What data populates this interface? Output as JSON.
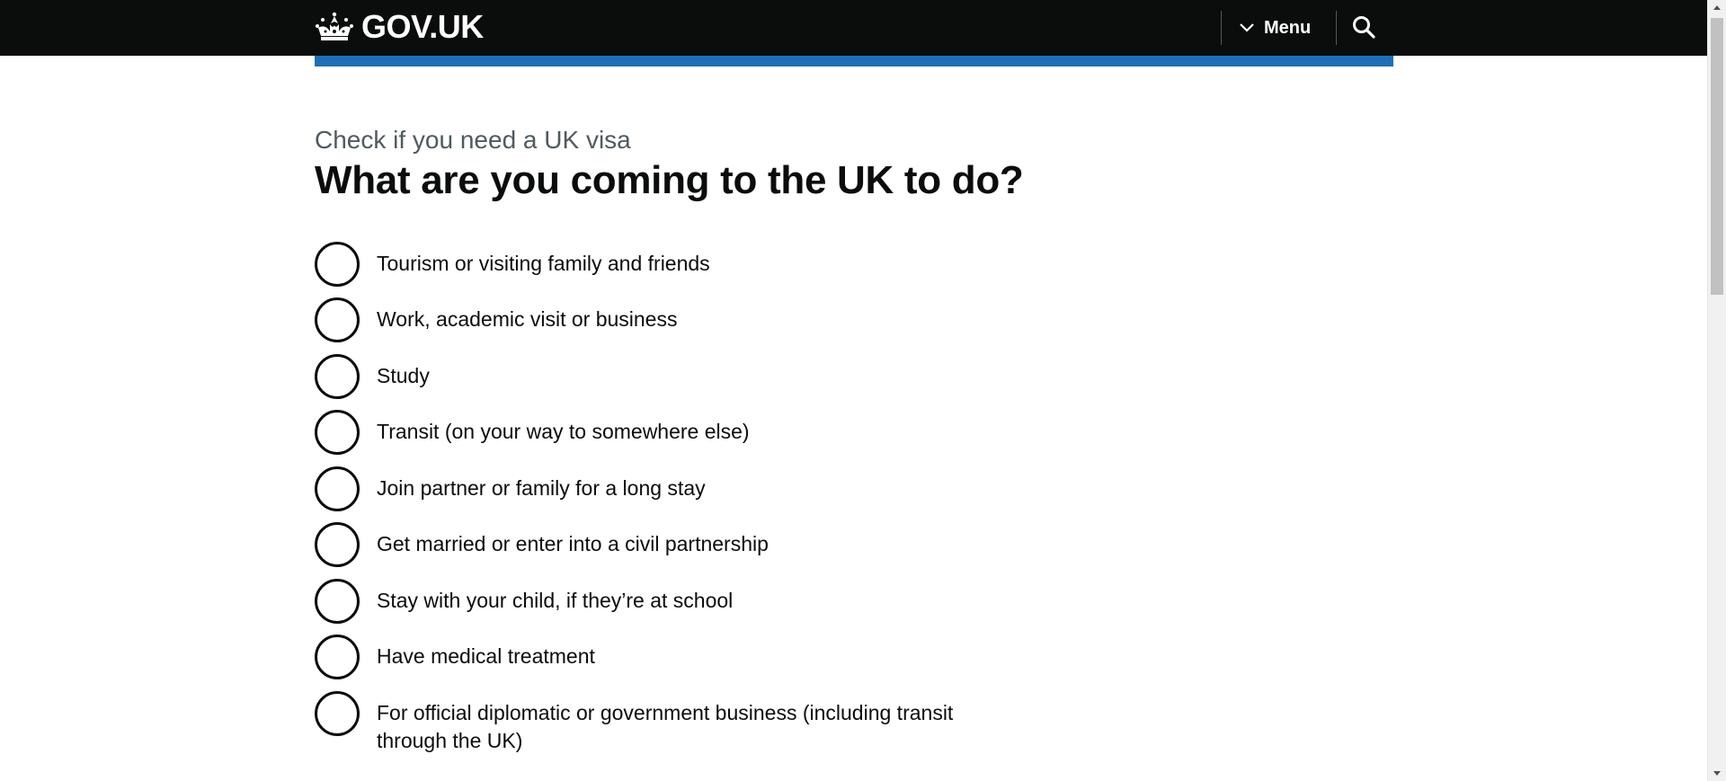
{
  "header": {
    "logo_text": "GOV.UK",
    "menu_label": "Menu",
    "colors": {
      "background": "#0b0c0c",
      "accent_rule": "#1d70b8"
    }
  },
  "main": {
    "caption": "Check if you need a UK visa",
    "heading": "What are you coming to the UK to do?",
    "options": [
      {
        "label": "Tourism or visiting family and friends",
        "selected": false
      },
      {
        "label": "Work, academic visit or business",
        "selected": false
      },
      {
        "label": "Study",
        "selected": false
      },
      {
        "label": "Transit (on your way to somewhere else)",
        "selected": false
      },
      {
        "label": "Join partner or family for a long stay",
        "selected": false
      },
      {
        "label": "Get married or enter into a civil partnership",
        "selected": false
      },
      {
        "label": "Stay with your child, if they’re at school",
        "selected": false
      },
      {
        "label": "Have medical treatment",
        "selected": false
      },
      {
        "label": "For official diplomatic or government business (including transit through the UK)",
        "selected": false
      }
    ]
  },
  "icons": {
    "logo": "crown-icon",
    "menu": "chevron-down-icon",
    "search": "search-icon"
  }
}
